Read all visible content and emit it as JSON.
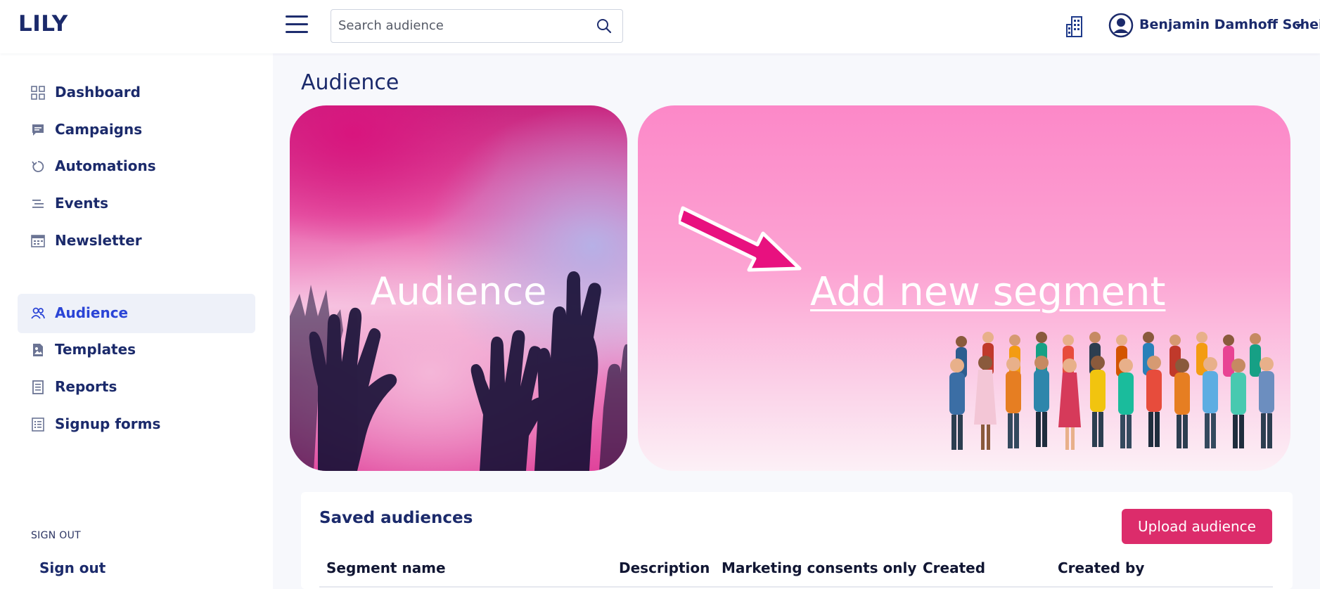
{
  "app": {
    "logo": "LILY"
  },
  "header": {
    "search_placeholder": "Search audience",
    "user_name": "Benjamin Damhoff Schei"
  },
  "sidebar": {
    "items": [
      {
        "label": "Dashboard",
        "icon": "grid-icon"
      },
      {
        "label": "Campaigns",
        "icon": "chat-icon"
      },
      {
        "label": "Automations",
        "icon": "refresh-icon"
      },
      {
        "label": "Events",
        "icon": "lines-icon"
      },
      {
        "label": "Newsletter",
        "icon": "calendar-icon"
      },
      {
        "label": "Audience",
        "icon": "users-icon",
        "active": true
      },
      {
        "label": "Templates",
        "icon": "image-file-icon"
      },
      {
        "label": "Reports",
        "icon": "document-icon"
      },
      {
        "label": "Signup forms",
        "icon": "form-icon"
      }
    ],
    "section_label": "SIGN OUT",
    "sign_out_label": "Sign out"
  },
  "main": {
    "title": "Audience",
    "card_audience_label": "Audience",
    "card_segment_label": "Add new segment",
    "saved": {
      "title": "Saved audiences",
      "upload_label": "Upload audience",
      "columns": [
        "Segment name",
        "Description",
        "Marketing consents only",
        "Created",
        "Created by"
      ]
    }
  },
  "colors": {
    "navy": "#1b2a6b",
    "active_blue": "#2a44d6",
    "button_pink": "#dc2c6b",
    "arrow_pink": "#e8117f"
  }
}
